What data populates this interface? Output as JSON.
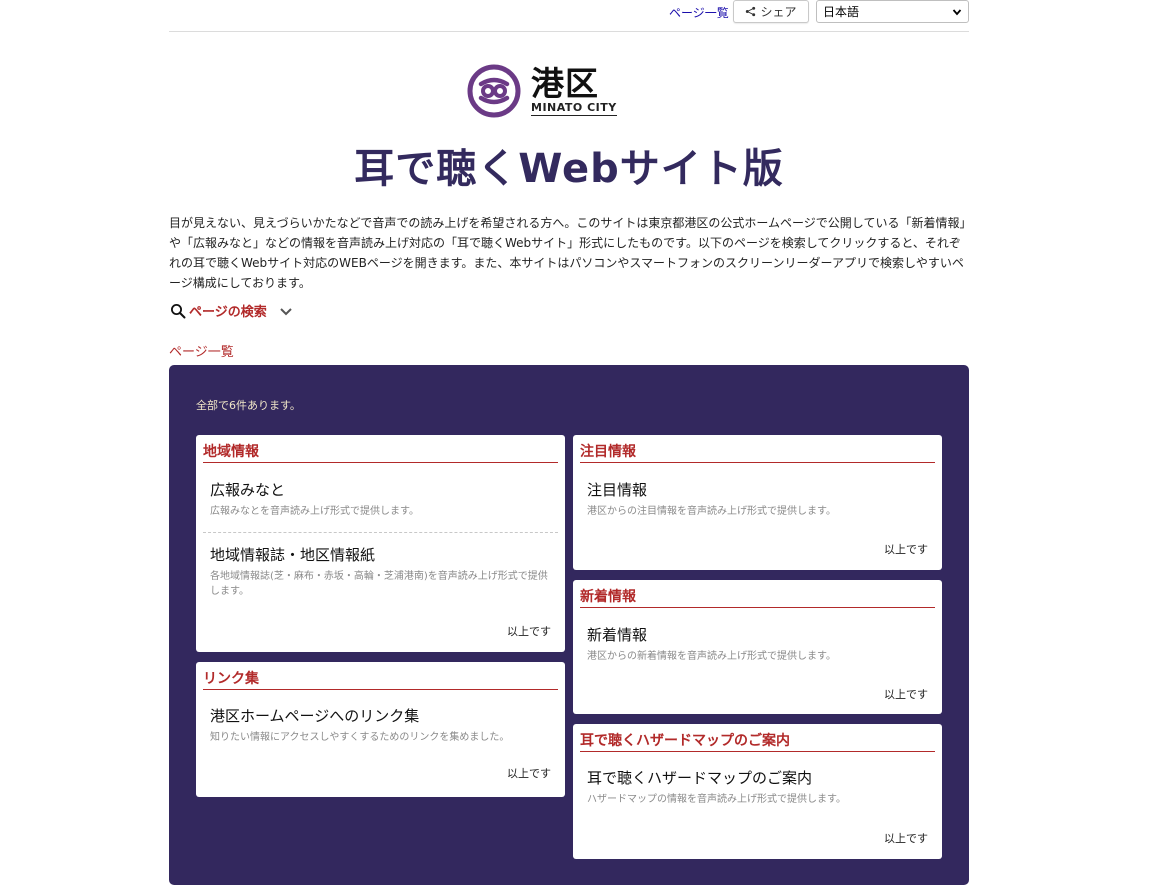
{
  "topbar": {
    "page_list_link": "ページ一覧",
    "share_label": "シェア",
    "language": "日本語"
  },
  "logo": {
    "kanji": "港区",
    "english": "MINATO CITY"
  },
  "title": "耳で聴くWebサイト版",
  "intro": "目が見えない、見えづらいかたなどで音声での読み上げを希望される方へ。このサイトは東京都港区の公式ホームページで公開している「新着情報」や「広報みなと」などの情報を音声読み上げ対応の「耳で聴くWebサイト」形式にしたものです。以下のページを検索してクリックすると、それぞれの耳で聴くWebサイト対応のWEBページを開きます。また、本サイトはパソコンやスマートフォンのスクリーンリーダーアプリで検索しやすいページ構成にしております。",
  "search": {
    "label": "ページの検索"
  },
  "page_list_label": "ページ一覧",
  "count_text": "全部で6件あります。",
  "end_label": "以上です",
  "colors": {
    "panel": "#33285e",
    "accent": "#b22a2a",
    "title": "#332a5e",
    "logo": "#6b3a86"
  },
  "sections": {
    "regional": {
      "heading": "地域情報",
      "items": [
        {
          "title": "広報みなと",
          "desc": "広報みなとを音声読み上げ形式で提供します。"
        },
        {
          "title": "地域情報誌・地区情報紙",
          "desc": "各地域情報誌(芝・麻布・赤坂・高輪・芝浦港南)を音声読み上げ形式で提供します。"
        }
      ]
    },
    "links": {
      "heading": "リンク集",
      "items": [
        {
          "title": "港区ホームページへのリンク集",
          "desc": "知りたい情報にアクセスしやすくするためのリンクを集めました。"
        }
      ]
    },
    "featured": {
      "heading": "注目情報",
      "items": [
        {
          "title": "注目情報",
          "desc": "港区からの注目情報を音声読み上げ形式で提供します。"
        }
      ]
    },
    "news": {
      "heading": "新着情報",
      "items": [
        {
          "title": "新着情報",
          "desc": "港区からの新着情報を音声読み上げ形式で提供します。"
        }
      ]
    },
    "hazard": {
      "heading": "耳で聴くハザードマップのご案内",
      "items": [
        {
          "title": "耳で聴くハザードマップのご案内",
          "desc": "ハザードマップの情報を音声読み上げ形式で提供します。"
        }
      ]
    }
  }
}
